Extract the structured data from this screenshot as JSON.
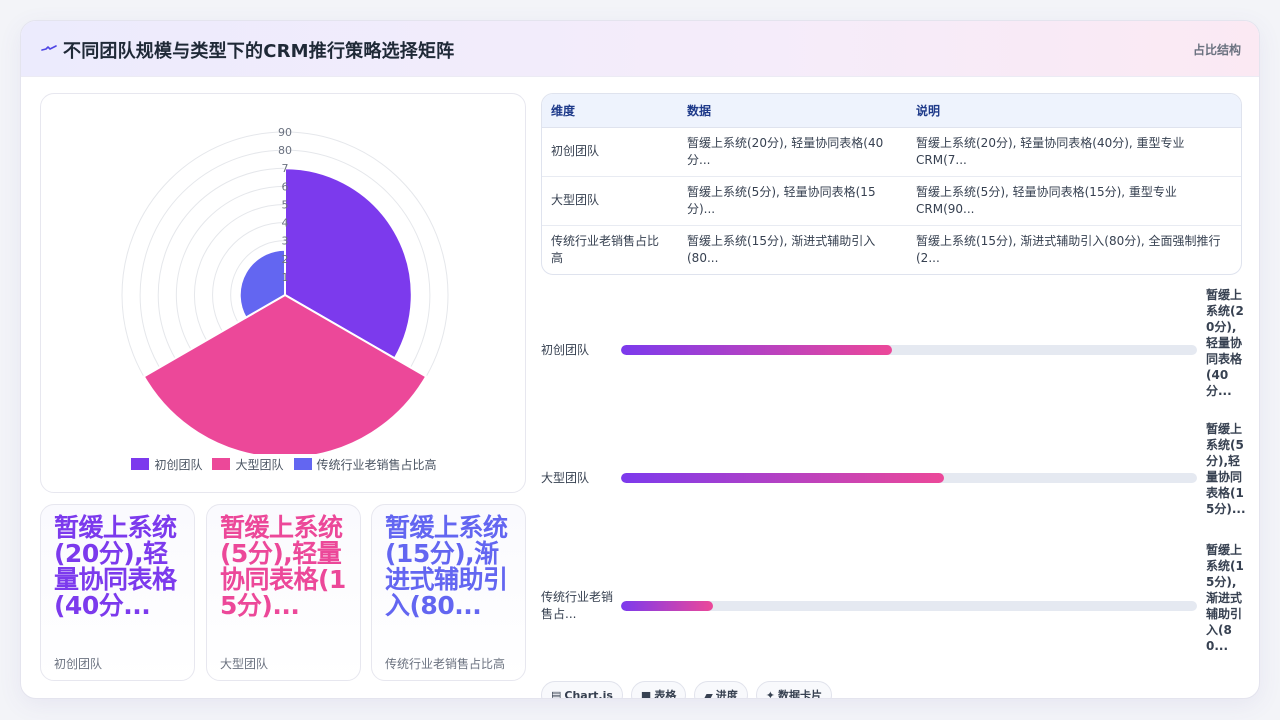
{
  "header": {
    "icon": "pulse-line-icon",
    "title": "不同团队规模与类型下的CRM推行策略选择矩阵",
    "right_label": "占比结构"
  },
  "colors": {
    "purple": "#7c3aed",
    "pink": "#ec4899",
    "indigo": "#6366f1"
  },
  "chart_data": {
    "type": "polarArea",
    "categories": [
      "初创团队",
      "大型团队",
      "传统行业老销售占比高"
    ],
    "values": [
      70,
      90,
      25
    ],
    "colors": [
      "#7c3aed",
      "#ec4899",
      "#6366f1"
    ],
    "r_ticks": [
      "1",
      "2",
      "3",
      "4",
      "5",
      "6",
      "7",
      "80",
      "90"
    ],
    "r_max": 90,
    "legend_position": "bottom"
  },
  "stats": [
    {
      "value": "暂缓上系统(20分),轻量协同表格(40分...",
      "label": "初创团队",
      "color": "#7c3aed"
    },
    {
      "value": "暂缓上系统(5分),轻量协同表格(15分)...",
      "label": "大型团队",
      "color": "#ec4899"
    },
    {
      "value": "暂缓上系统(15分),渐进式辅助引入(80...",
      "label": "传统行业老销售占比高",
      "color": "#6366f1"
    }
  ],
  "table": {
    "headers": [
      "维度",
      "数据",
      "说明"
    ],
    "rows": [
      [
        "初创团队",
        "暂缓上系统(20分), 轻量协同表格(40分...",
        "暂缓上系统(20分), 轻量协同表格(40分), 重型专业CRM(7..."
      ],
      [
        "大型团队",
        "暂缓上系统(5分), 轻量协同表格(15分)...",
        "暂缓上系统(5分), 轻量协同表格(15分), 重型专业CRM(90..."
      ],
      [
        "传统行业老销售占比高",
        "暂缓上系统(15分), 渐进式辅助引入(80...",
        "暂缓上系统(15分), 渐进式辅助引入(80分), 全面强制推行(2..."
      ]
    ]
  },
  "progress": [
    {
      "label": "初创团队",
      "value": "暂缓上系统(20分),轻量协同表格(40分...",
      "fraction": 0.47
    },
    {
      "label": "大型团队",
      "value": "暂缓上系统(5分),轻量协同表格(15分)...",
      "fraction": 0.56
    },
    {
      "label": "传统行业老销售占...",
      "value": "暂缓上系统(15分),渐进式辅助引入(80...",
      "fraction": 0.16
    }
  ],
  "chips": [
    {
      "icon": "chart-icon",
      "glyph": "▤",
      "label": "Chart.js"
    },
    {
      "icon": "table-icon",
      "glyph": "■",
      "label": "表格"
    },
    {
      "icon": "progress-icon",
      "glyph": "▰",
      "label": "进度"
    },
    {
      "icon": "sparkle-icon",
      "glyph": "✦",
      "label": "数据卡片"
    }
  ]
}
